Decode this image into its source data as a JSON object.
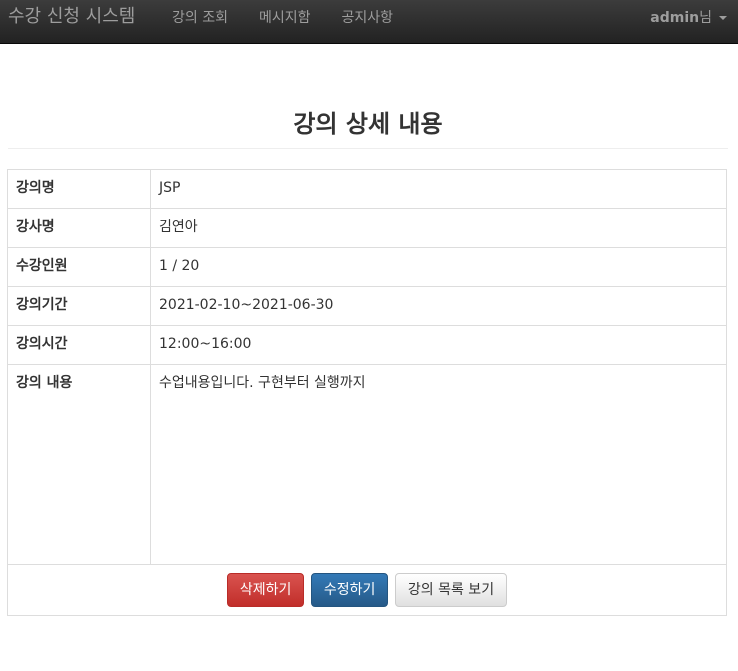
{
  "navbar": {
    "brand": "수강 신청 시스템",
    "links": [
      "강의 조회",
      "메시지함",
      "공지사항"
    ],
    "user": {
      "name": "admin",
      "suffix": "님"
    }
  },
  "page": {
    "title": "강의 상세 내용"
  },
  "detail": {
    "rows": [
      {
        "label": "강의명",
        "value": "JSP"
      },
      {
        "label": "강사명",
        "value": "김연아"
      },
      {
        "label": "수강인원",
        "value": "1 / 20"
      },
      {
        "label": "강의기간",
        "value": "2021-02-10~2021-06-30"
      },
      {
        "label": "강의시간",
        "value": "12:00~16:00"
      },
      {
        "label": "강의 내용",
        "value": "수업내용입니다. 구현부터 실행까지"
      }
    ]
  },
  "actions": {
    "delete_label": "삭제하기",
    "edit_label": "수정하기",
    "list_label": "강의 목록 보기"
  },
  "colors": {
    "navbar_bg": "#222222",
    "nav_text": "#9d9d9d",
    "danger": "#d9534f",
    "primary": "#337ab7",
    "border": "#dddddd"
  }
}
